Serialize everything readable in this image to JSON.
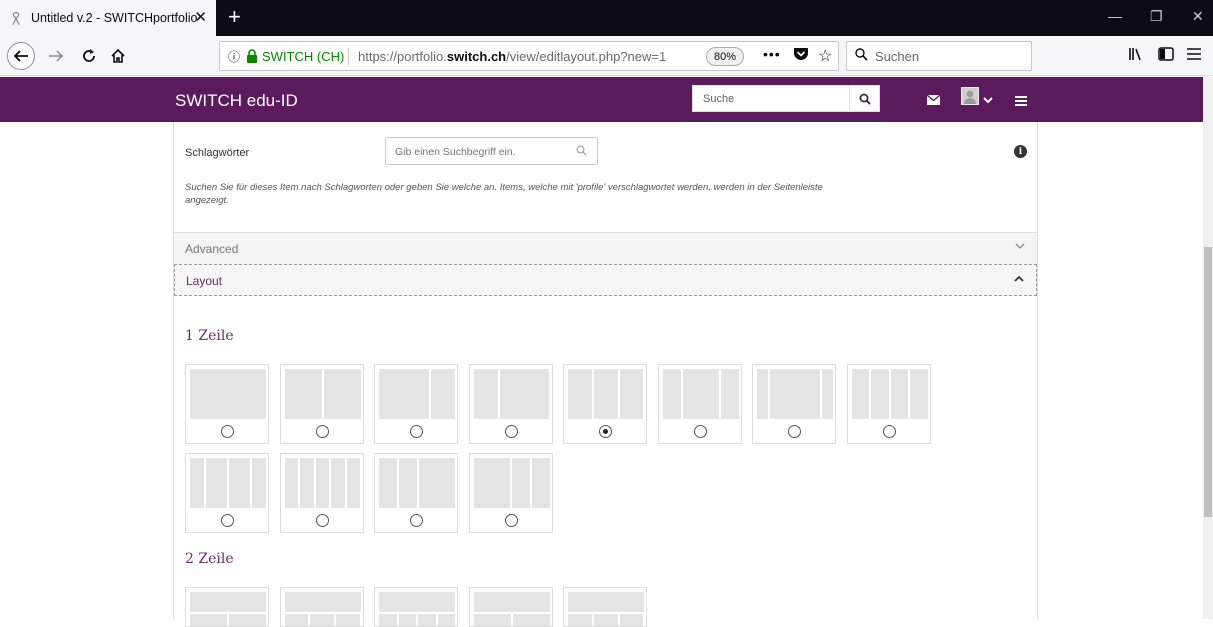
{
  "browser": {
    "tab_title": "Untitled v.2 - SWITCHportfolio",
    "tab_close": "✕",
    "new_tab": "+",
    "window_controls": [
      "—",
      "❐",
      "✕"
    ],
    "identity_org": "SWITCH (CH)",
    "url_prefix": "https://portfolio.",
    "url_domain": "switch.ch",
    "url_path": "/view/editlayout.php?new=1",
    "zoom": "80%",
    "search_placeholder": "Suchen",
    "icons": [
      "back-arrow",
      "forward-arrow",
      "reload",
      "home",
      "info",
      "lock",
      "page-actions",
      "pocket",
      "bookmark-star",
      "search",
      "library",
      "sidebar",
      "menu"
    ]
  },
  "site": {
    "brand": "SWITCH edu-ID",
    "search_placeholder": "Suche",
    "accent": "#5b1a5c"
  },
  "form": {
    "tags_label": "Schlagwörter",
    "tags_placeholder": "Gib einen Suchbegriff ein.",
    "tags_description": "Suchen Sie für dieses Item nach Schlagworten oder geben Sie welche an. Items, welche mit 'profile' verschlagwortet werden, werden in der Seitenleiste angezeigt.",
    "advanced_label": "Advanced",
    "layout_label": "Layout"
  },
  "layouts": {
    "row1_heading": "1 Zeile",
    "row2_heading": "2 Zeile",
    "row1_options": [
      {
        "cols": [
          100
        ],
        "selected": false
      },
      {
        "cols": [
          50,
          50
        ],
        "selected": false
      },
      {
        "cols": [
          67,
          33
        ],
        "selected": false
      },
      {
        "cols": [
          33,
          67
        ],
        "selected": false
      },
      {
        "cols": [
          33,
          33,
          33
        ],
        "selected": true
      },
      {
        "cols": [
          25,
          50,
          25
        ],
        "selected": false
      },
      {
        "cols": [
          15,
          70,
          15
        ],
        "selected": false
      },
      {
        "cols": [
          25,
          25,
          25,
          25
        ],
        "selected": false
      },
      {
        "cols": [
          20,
          30,
          30,
          20
        ],
        "selected": false
      },
      {
        "cols": [
          20,
          20,
          20,
          20,
          20
        ],
        "selected": false
      },
      {
        "cols": [
          25,
          25,
          50
        ],
        "selected": false
      },
      {
        "cols": [
          50,
          25,
          25
        ],
        "selected": false
      }
    ],
    "row2_options": [
      {
        "top": [
          100
        ],
        "bottom": [
          50,
          50
        ]
      },
      {
        "top": [
          100
        ],
        "bottom": [
          33,
          33,
          33
        ]
      },
      {
        "top": [
          100
        ],
        "bottom": [
          25,
          25,
          25,
          25
        ]
      },
      {
        "top": [
          100
        ],
        "bottom": [
          50,
          50
        ]
      },
      {
        "top": [
          100
        ],
        "bottom": [
          33,
          33,
          33
        ]
      }
    ]
  }
}
